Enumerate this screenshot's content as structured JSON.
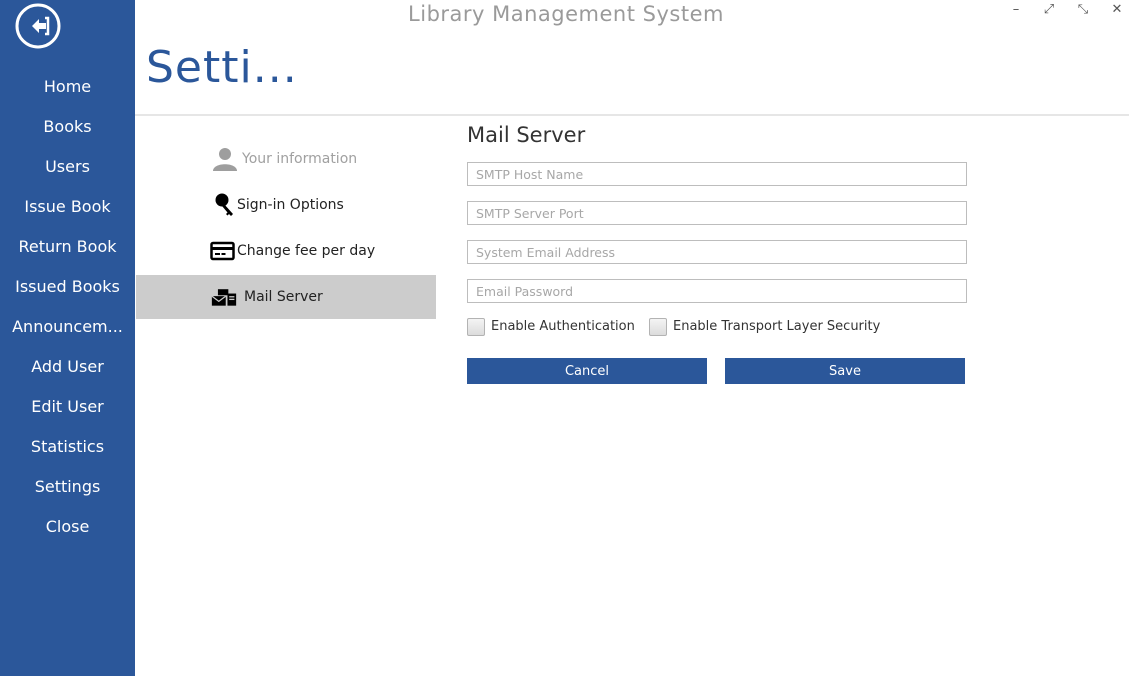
{
  "window": {
    "title": "Library Management System",
    "controls": [
      "–",
      "⤢",
      "⤡",
      "✕"
    ]
  },
  "page_title": "Setti...",
  "sidebar": {
    "items": [
      {
        "label": "Home"
      },
      {
        "label": "Books"
      },
      {
        "label": "Users"
      },
      {
        "label": "Issue Book"
      },
      {
        "label": "Return Book"
      },
      {
        "label": "Issued Books"
      },
      {
        "label": "Announcem..."
      },
      {
        "label": "Add User"
      },
      {
        "label": "Edit User"
      },
      {
        "label": "Statistics"
      },
      {
        "label": "Settings"
      },
      {
        "label": "Close"
      }
    ],
    "back_icon": "back-arrow-circle-icon"
  },
  "categories": [
    {
      "label": "Your information",
      "icon": "user-icon",
      "enabled": false
    },
    {
      "label": "Sign-in Options",
      "icon": "key-icon",
      "enabled": true
    },
    {
      "label": "Change fee per day",
      "icon": "credit-card-icon",
      "enabled": true
    },
    {
      "label": "Mail Server",
      "icon": "mail-server-icon",
      "enabled": true,
      "selected": true
    }
  ],
  "mail_server": {
    "heading": "Mail Server",
    "fields": {
      "smtp_host": {
        "placeholder": "SMTP Host Name",
        "value": ""
      },
      "smtp_port": {
        "placeholder": "SMTP Server Port",
        "value": ""
      },
      "system_email": {
        "placeholder": "System Email Address",
        "value": ""
      },
      "email_password": {
        "placeholder": "Email Password",
        "value": ""
      }
    },
    "checkboxes": [
      {
        "label": "Enable Authentication",
        "checked": false
      },
      {
        "label": "Enable Transport Layer Security",
        "checked": false
      }
    ],
    "cancel_label": "Cancel",
    "save_label": "Save"
  },
  "colors": {
    "accent": "#2b579a",
    "selected_category": "#cccccc"
  }
}
